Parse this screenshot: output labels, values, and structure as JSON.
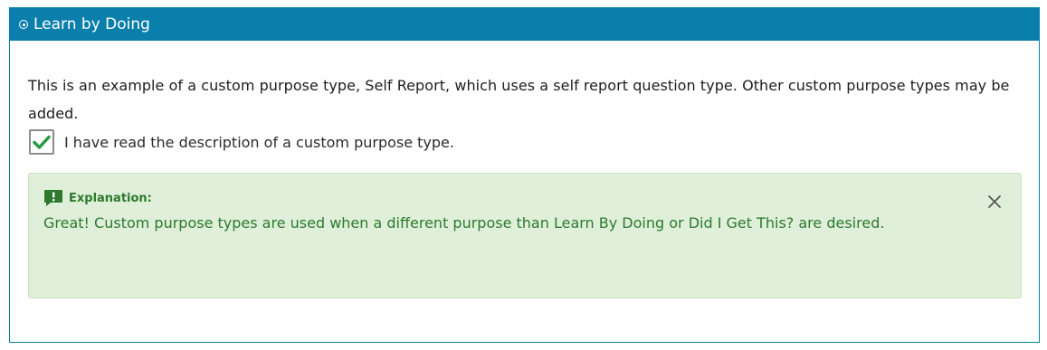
{
  "panel": {
    "title": "Learn by Doing"
  },
  "question": {
    "description": "This is an example of a custom purpose type, Self Report, which uses a self report question type. Other custom purpose types may be added.",
    "checkbox_label": "I have read the description of a custom purpose type.",
    "checkbox_checked": true
  },
  "feedback": {
    "title": "Explanation:",
    "text": "Great! Custom purpose types are used when a different purpose than Learn By Doing or Did I Get This? are desired."
  },
  "colors": {
    "header": "#0a7fac",
    "feedback_bg": "#dfefda",
    "feedback_text": "#2d7a2d",
    "check": "#2a9a47"
  }
}
